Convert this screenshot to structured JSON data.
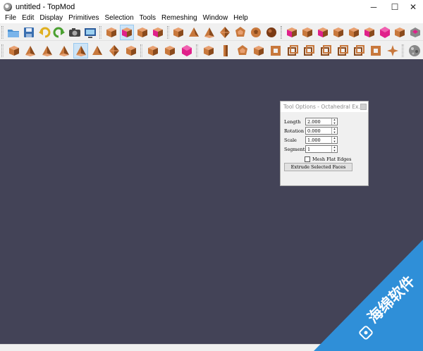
{
  "window": {
    "title": "untitled - TopMod",
    "min_symbol": "─",
    "max_symbol": "☐",
    "close_symbol": "✕"
  },
  "menu": [
    "File",
    "Edit",
    "Display",
    "Primitives",
    "Selection",
    "Tools",
    "Remeshing",
    "Window",
    "Help"
  ],
  "toolbar1": {
    "file_icons": [
      "open-folder-icon",
      "save-disk-icon",
      "undo-icon",
      "redo-icon",
      "camera-icon",
      "screenshot-icon"
    ],
    "select_icons": [
      {
        "name": "select-vertex-icon",
        "active": false
      },
      {
        "name": "select-face-icon",
        "active": true
      },
      {
        "name": "select-edge-icon",
        "active": false
      },
      {
        "name": "select-corner-icon",
        "active": false
      }
    ],
    "primitive_icons": [
      "cube-primitive-icon",
      "tetrahedron-primitive-icon",
      "pyramid-primitive-icon",
      "octahedron-primitive-icon",
      "dodecahedron-primitive-icon",
      "icosahedron-primitive-icon",
      "soccerball-primitive-icon"
    ],
    "tool_icons": [
      "insert-edge-icon",
      "delete-edge-icon",
      "collapse-edge-icon",
      "subdivide-edge-icon",
      "connect-edges-icon",
      "splice-corners-icon",
      "transforms-icon",
      "selection-options-icon",
      "extrude-tool-icon"
    ]
  },
  "toolbar2": {
    "extrude_icons": [
      {
        "name": "cubical-extrude-icon",
        "active": false
      },
      {
        "name": "dodecahedral-extrude-icon",
        "active": false
      },
      {
        "name": "icosahedral-extrude-icon",
        "active": false
      },
      {
        "name": "octahedral-extrude-icon",
        "active": false
      },
      {
        "name": "stellate-extrude-icon",
        "active": true
      },
      {
        "name": "double-stellate-extrude-icon",
        "active": false
      },
      {
        "name": "dome-extrude-icon",
        "active": false
      },
      {
        "name": "hemispherical-extrude-icon",
        "active": false
      }
    ],
    "conical_icons": [
      "conical-icon",
      "rind-icon",
      "wireframe-icon"
    ],
    "remesh_icons": [
      "sculpting-icon",
      "column-modeling-icon",
      "doo-sabin-icon",
      "catmull-clark-icon",
      "wireframe-remesh-icon",
      "corner-cutting-icon",
      "loop-style-icon",
      "simplest-remesh-icon",
      "pentagonal-icon",
      "hexagonal-icon",
      "honeycomb-icon",
      "fractal-icon"
    ],
    "extra_icons": [
      "texture-sphere-icon"
    ]
  },
  "tool_dialog": {
    "title": "Tool Options - Octahedral Ex...",
    "fields": [
      {
        "label": "Length",
        "value": "2.000"
      },
      {
        "label": "Rotation",
        "value": "0.000"
      },
      {
        "label": "Scale",
        "value": "1.000"
      },
      {
        "label": "Segments",
        "value": "1"
      }
    ],
    "checkbox_label": "Mesh Flat Edges",
    "checkbox_checked": false,
    "button_label": "Extrude Selected Faces"
  },
  "watermark": {
    "text": "海绵软件",
    "color": "#2f8fd8"
  },
  "colors": {
    "viewport": "#434357",
    "mesh_orange": "#c8783c",
    "mesh_pink": "#e0208a"
  }
}
